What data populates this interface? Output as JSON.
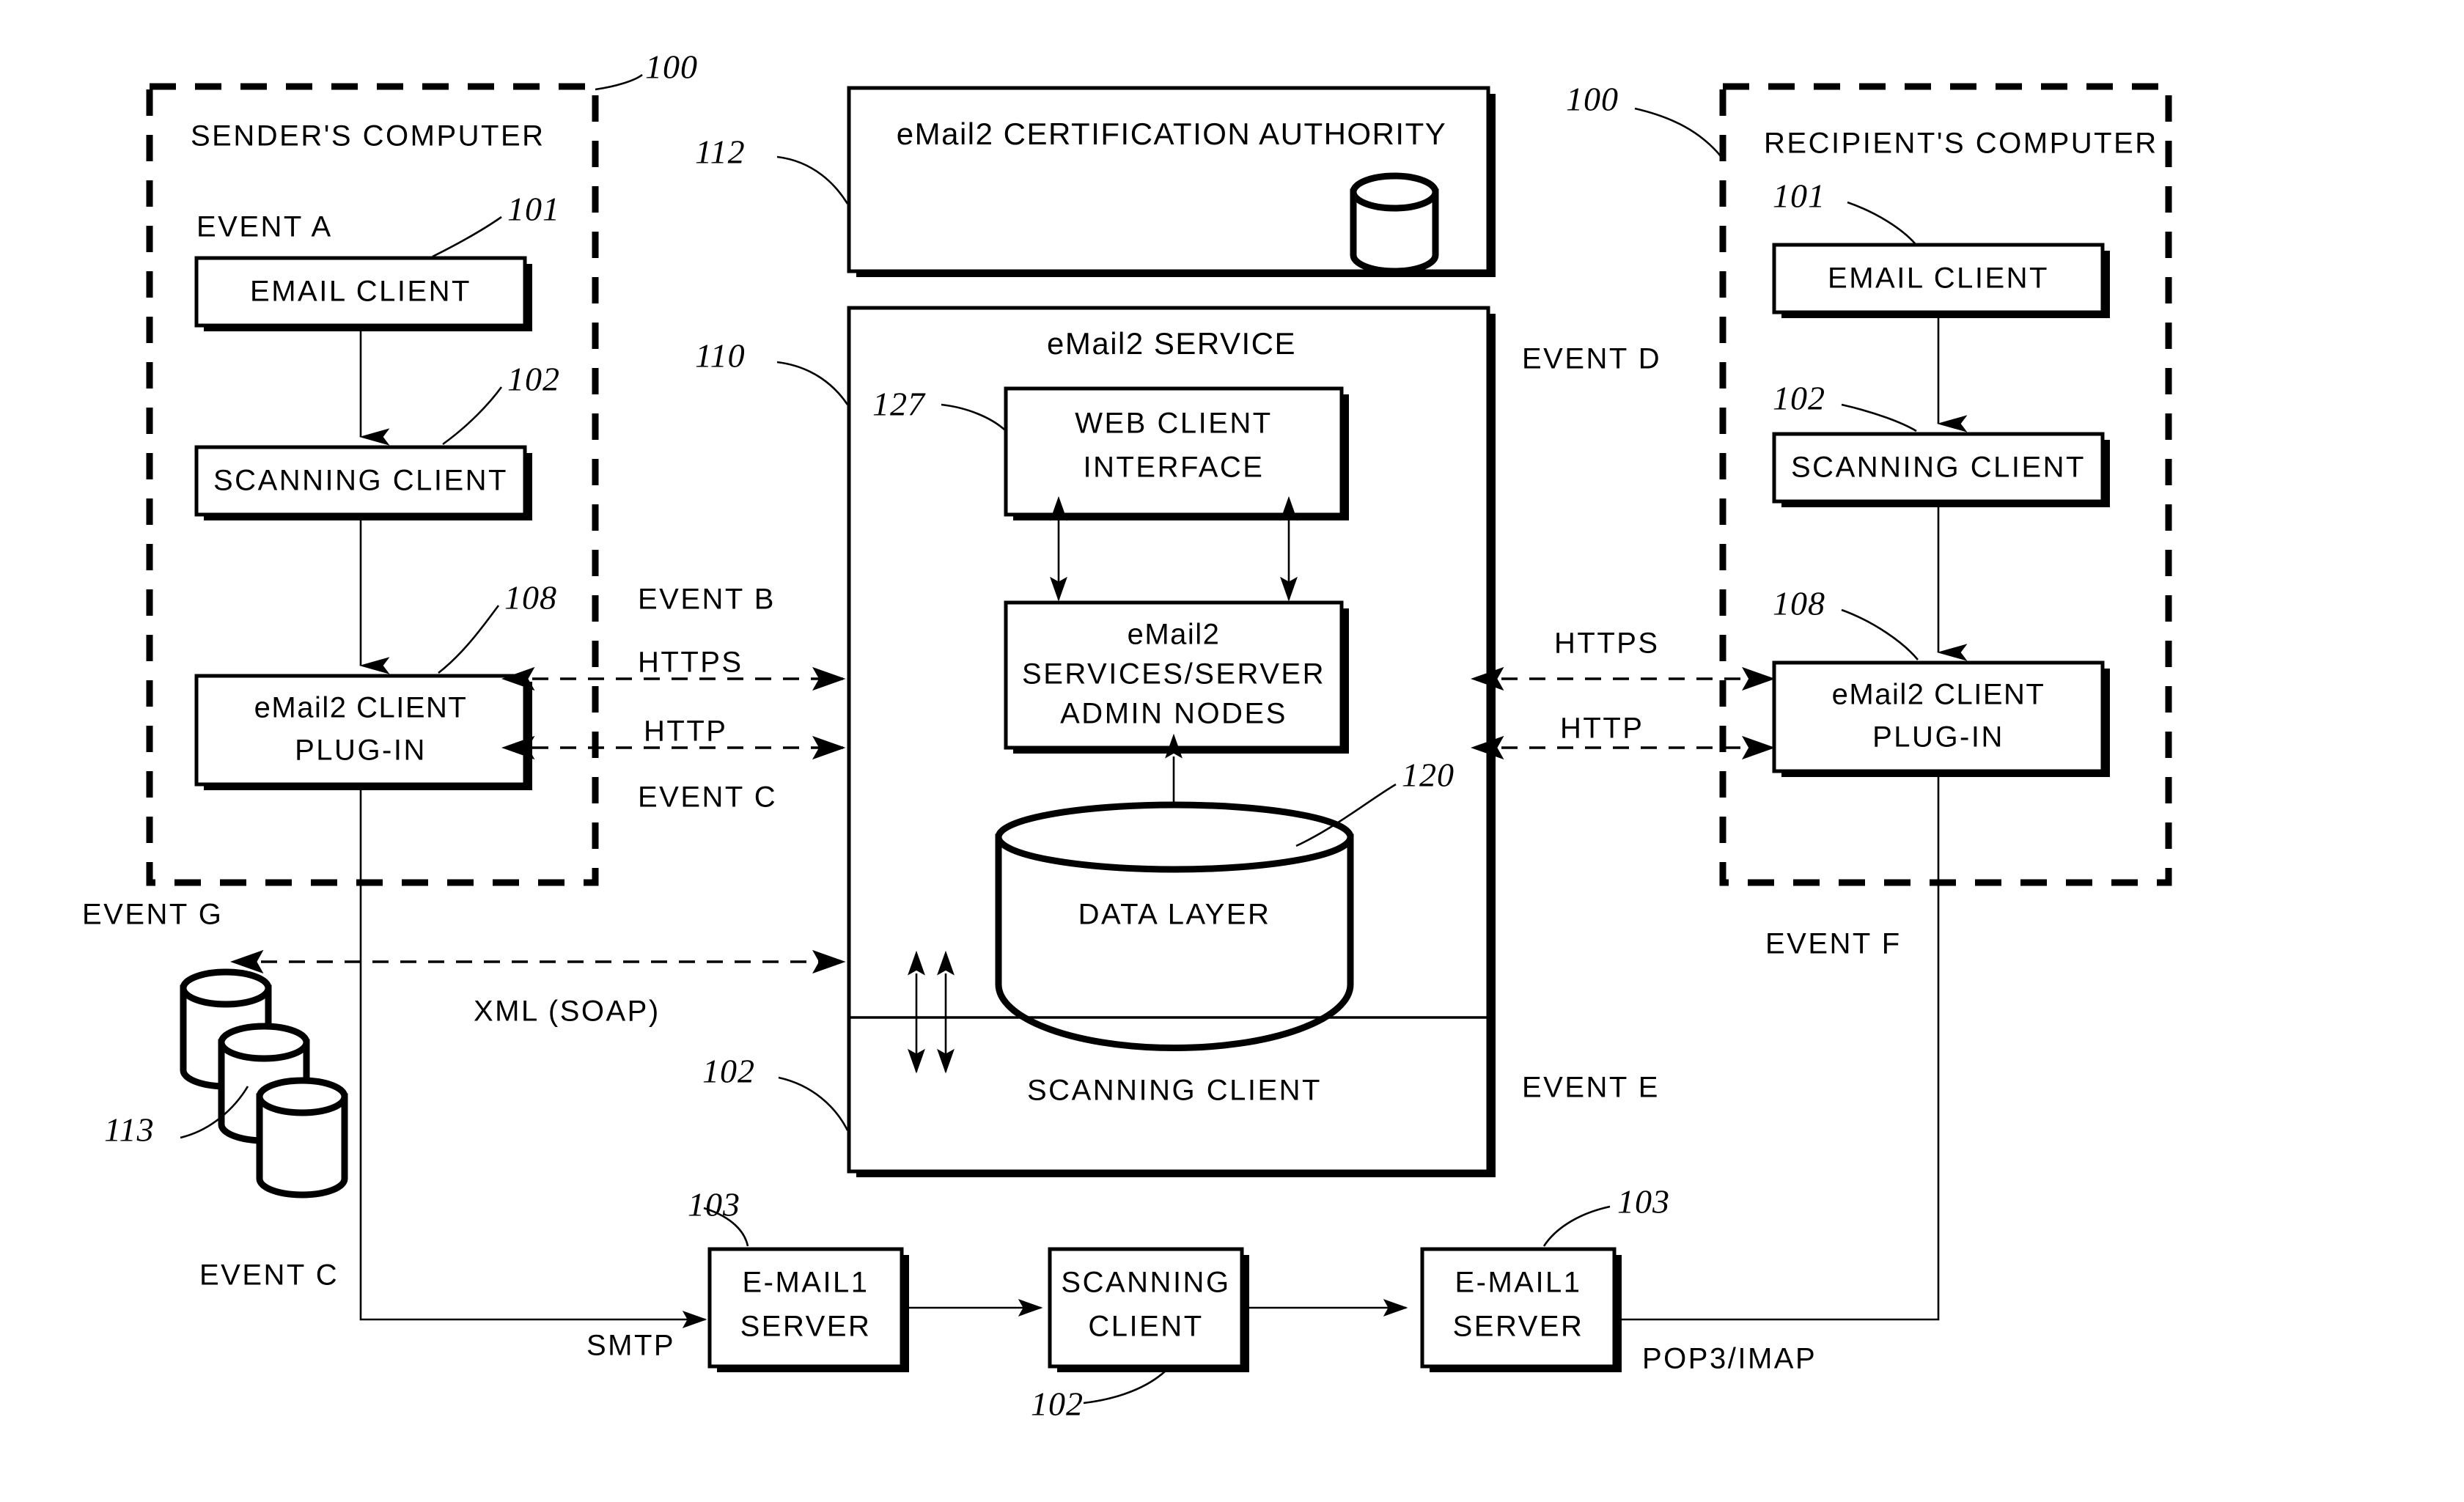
{
  "figure": {
    "title_hidden": "",
    "ref_numbers": {
      "sender_computer": "100",
      "recipient_computer": "100",
      "email_client_sender": "101",
      "email_client_recipient": "101",
      "scanning_client_sender": "102",
      "scanning_client_recipient": "102",
      "scanning_client_service": "102",
      "scanning_client_bottom": "102",
      "email1_server_left": "103",
      "email1_server_right": "103",
      "email2_plugin_sender": "108",
      "email2_plugin_recipient": "108",
      "email2_service": "110",
      "certification_authority": "112",
      "external_databases": "113",
      "data_layer": "120",
      "web_client_interface": "127"
    }
  },
  "sender": {
    "container_label": "SENDER'S COMPUTER",
    "event_a": "EVENT A",
    "email_client": "EMAIL CLIENT",
    "scanning_client": "SCANNING CLIENT",
    "email2_plugin_line1": "eMail2 CLIENT",
    "email2_plugin_line2": "PLUG-IN"
  },
  "recipient": {
    "container_label": "RECIPIENT'S COMPUTER",
    "email_client": "EMAIL CLIENT",
    "scanning_client": "SCANNING CLIENT",
    "email2_plugin_line1": "eMail2 CLIENT",
    "email2_plugin_line2": "PLUG-IN"
  },
  "certification_authority": {
    "title": "eMail2 CERTIFICATION AUTHORITY",
    "db_icon": "cylinder-database-icon"
  },
  "service": {
    "title": "eMail2 SERVICE",
    "web_client_interface_line1": "WEB CLIENT",
    "web_client_interface_line2": "INTERFACE",
    "admin_nodes_line1": "eMail2",
    "admin_nodes_line2": "SERVICES/SERVER",
    "admin_nodes_line3": "ADMIN NODES",
    "data_layer": "DATA LAYER",
    "scanning_client": "SCANNING CLIENT"
  },
  "bottom_chain": {
    "email1_server_left": [
      "E-MAIL1",
      "SERVER"
    ],
    "scanning_client": [
      "SCANNING",
      "CLIENT"
    ],
    "email1_server_right": [
      "E-MAIL1",
      "SERVER"
    ]
  },
  "events": {
    "a": "EVENT A",
    "b": "EVENT B",
    "c_left": "EVENT C",
    "c_bottom": "EVENT C",
    "d": "EVENT D",
    "e": "EVENT E",
    "f": "EVENT F",
    "g": "EVENT G"
  },
  "protocols": {
    "https_left": "HTTPS",
    "http_left": "HTTP",
    "https_right": "HTTPS",
    "http_right": "HTTP",
    "xml_soap": "XML (SOAP)",
    "smtp": "SMTP",
    "pop3_imap": "POP3/IMAP"
  },
  "colors": {
    "ink": "#000000",
    "paper": "#ffffff"
  }
}
